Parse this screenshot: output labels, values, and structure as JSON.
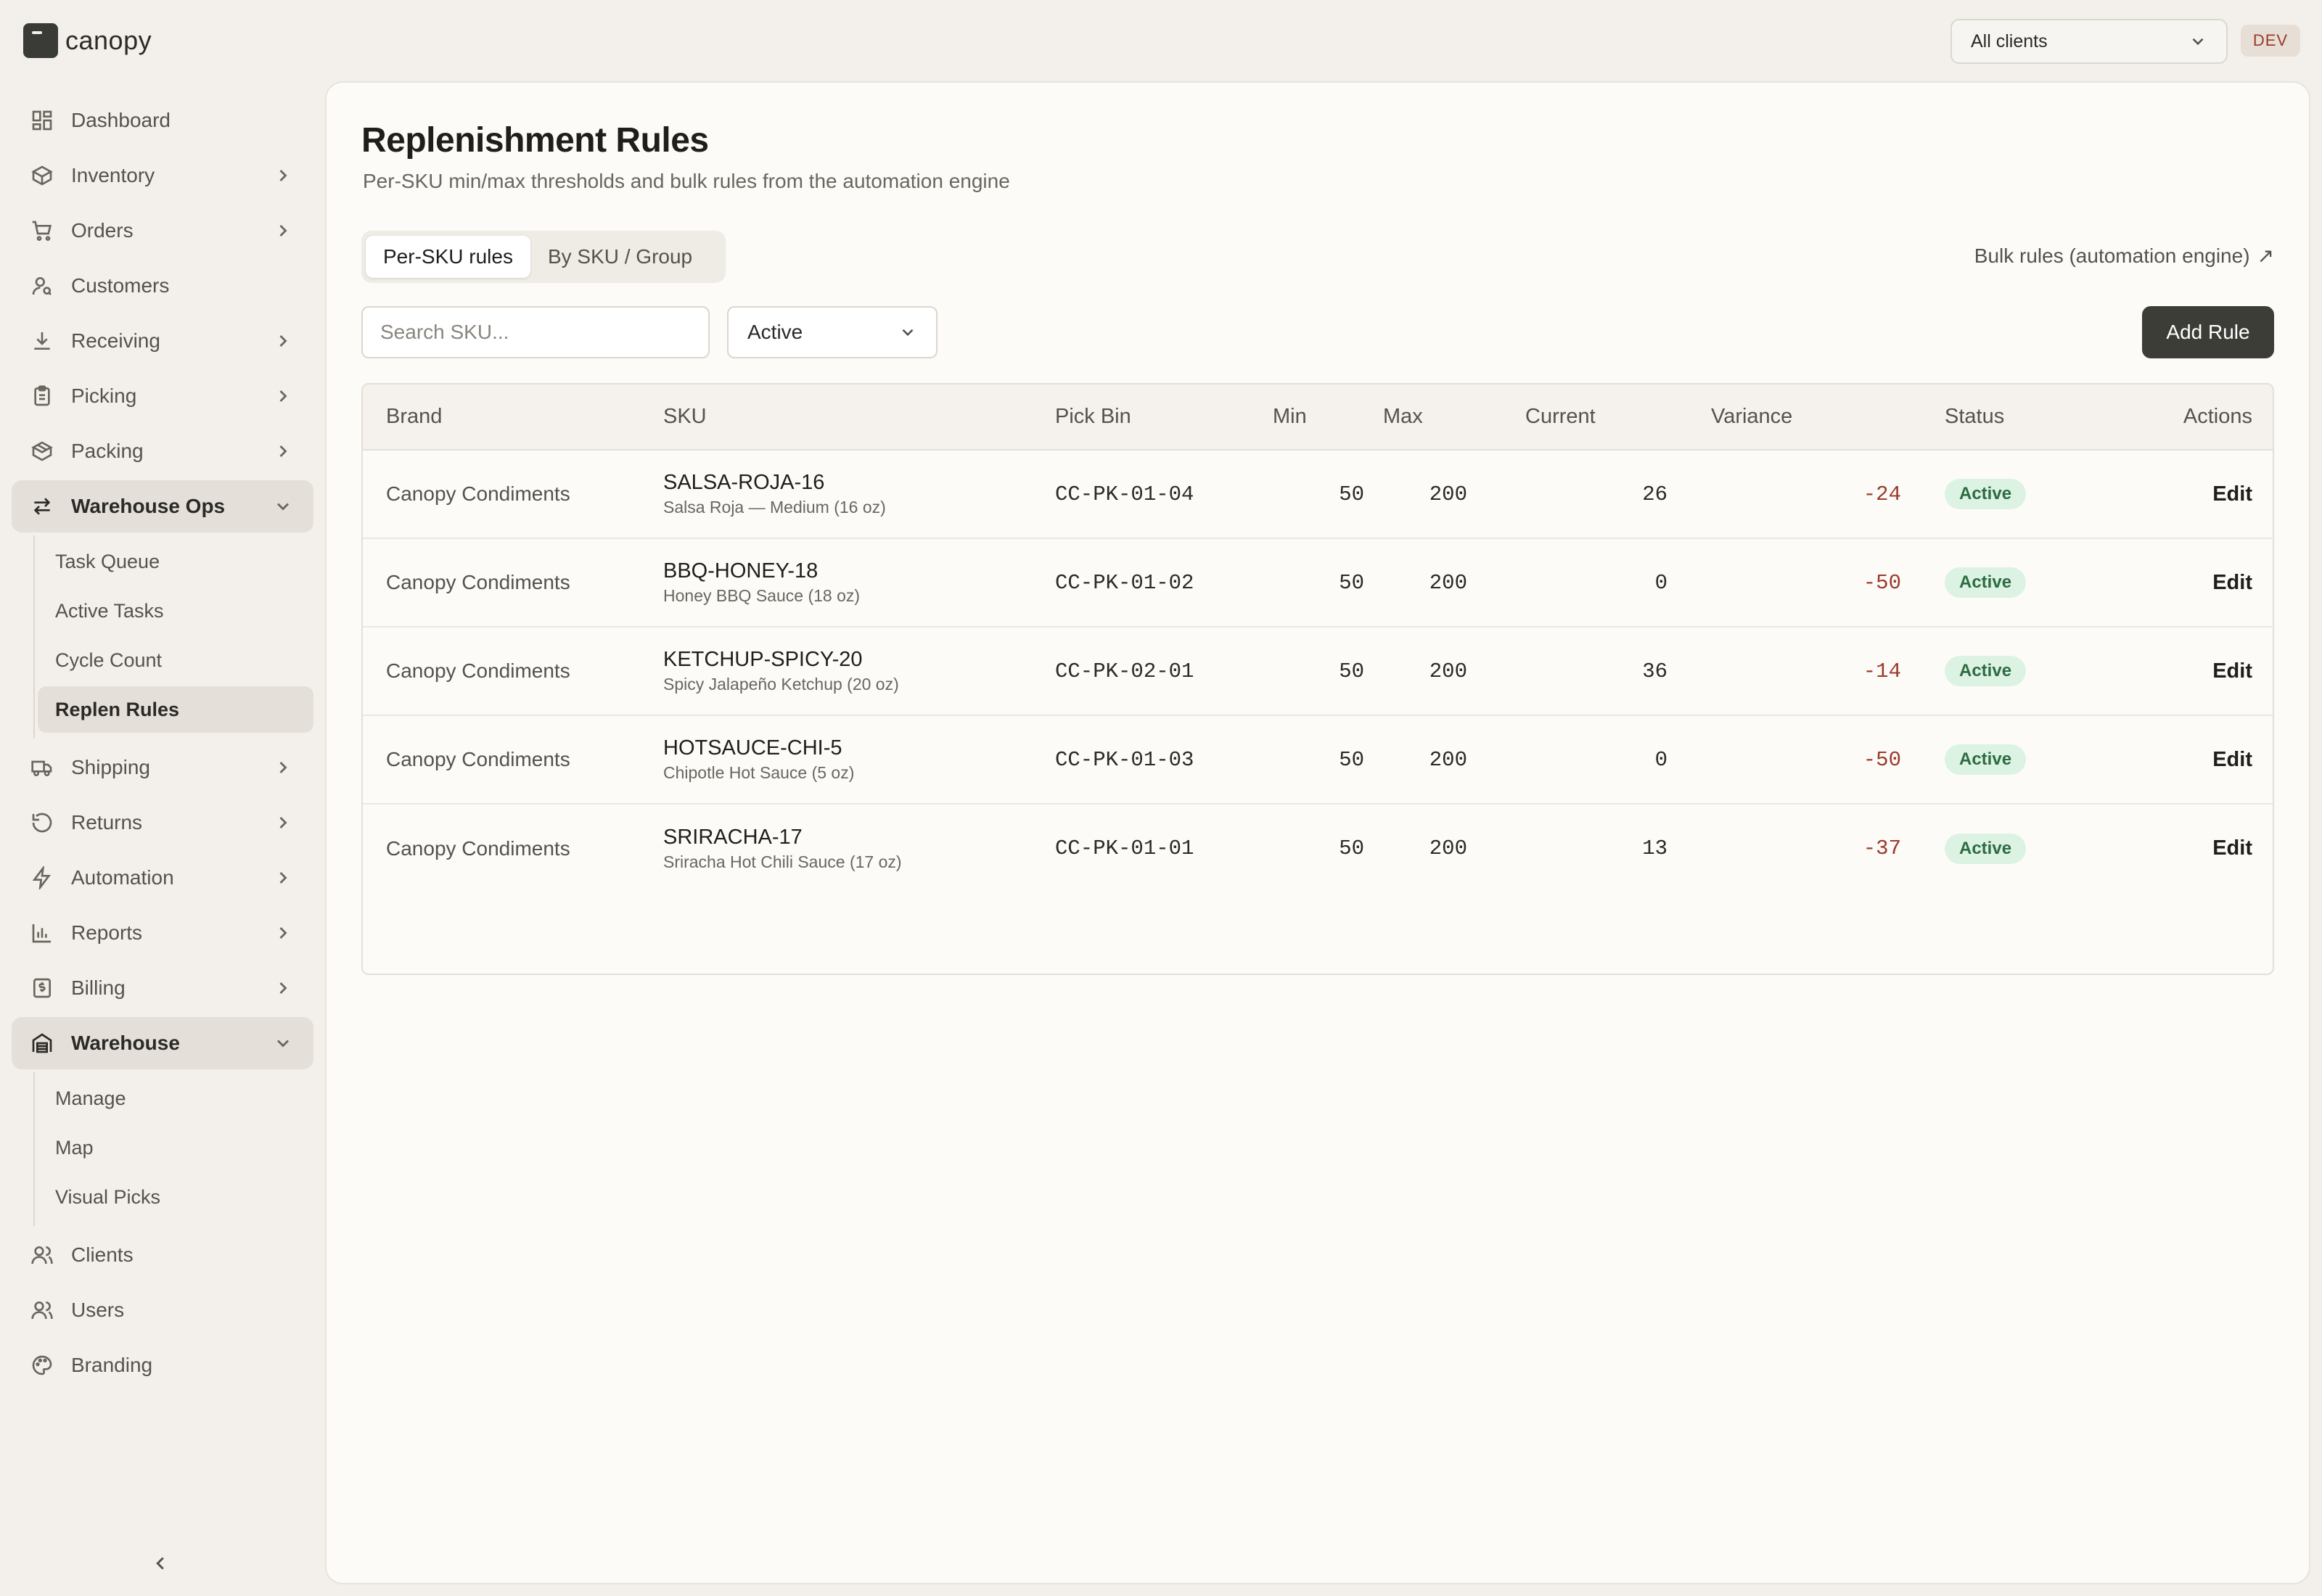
{
  "app": {
    "logo_text": "canopy",
    "client_select": "All clients",
    "env_badge": "DEV"
  },
  "sidebar": {
    "items": [
      {
        "label": "Dashboard",
        "icon": "dashboard-icon",
        "chevron": false
      },
      {
        "label": "Inventory",
        "icon": "box-icon",
        "chevron": true
      },
      {
        "label": "Orders",
        "icon": "cart-icon",
        "chevron": true
      },
      {
        "label": "Customers",
        "icon": "user-search-icon",
        "chevron": false
      },
      {
        "label": "Receiving",
        "icon": "download-icon",
        "chevron": true
      },
      {
        "label": "Picking",
        "icon": "clipboard-icon",
        "chevron": true
      },
      {
        "label": "Packing",
        "icon": "package-icon",
        "chevron": true
      },
      {
        "label": "Warehouse Ops",
        "icon": "arrows-exchange-icon",
        "expanded": true,
        "children": [
          "Task Queue",
          "Active Tasks",
          "Cycle Count",
          "Replen Rules"
        ],
        "active_child": "Replen Rules"
      },
      {
        "label": "Shipping",
        "icon": "truck-icon",
        "chevron": true
      },
      {
        "label": "Returns",
        "icon": "rotate-ccw-icon",
        "chevron": true
      },
      {
        "label": "Automation",
        "icon": "bolt-icon",
        "chevron": true
      },
      {
        "label": "Reports",
        "icon": "bar-chart-icon",
        "chevron": true
      },
      {
        "label": "Billing",
        "icon": "dollar-receipt-icon",
        "chevron": true
      },
      {
        "label": "Warehouse",
        "icon": "warehouse-icon",
        "expanded": true,
        "children": [
          "Manage",
          "Map",
          "Visual Picks"
        ]
      },
      {
        "label": "Clients",
        "icon": "users-icon",
        "chevron": false
      },
      {
        "label": "Users",
        "icon": "users-icon",
        "chevron": false
      },
      {
        "label": "Branding",
        "icon": "palette-icon",
        "chevron": false
      }
    ]
  },
  "page": {
    "title": "Replenishment Rules",
    "subtitle": "Per-SKU min/max thresholds and bulk rules from the automation engine",
    "tabs": [
      "Per-SKU rules",
      "By SKU / Group"
    ],
    "active_tab": "Per-SKU rules",
    "bulk_link": "Bulk rules (automation engine)",
    "bulk_link_icon": "arrow-up-right-icon",
    "search_placeholder": "Search SKU...",
    "status_filter": "Active",
    "add_button": "Add Rule"
  },
  "table": {
    "columns": [
      "Brand",
      "SKU",
      "Pick Bin",
      "Min",
      "Max",
      "Current",
      "Variance",
      "Status",
      "Actions"
    ],
    "rows": [
      {
        "brand": "Canopy Condiments",
        "sku": "SALSA-ROJA-16",
        "name": "Salsa Roja — Medium (16 oz)",
        "bin": "CC-PK-01-04",
        "min": "50",
        "max": "200",
        "current": "26",
        "variance": "-24",
        "status": "Active",
        "action": "Edit"
      },
      {
        "brand": "Canopy Condiments",
        "sku": "BBQ-HONEY-18",
        "name": "Honey BBQ Sauce (18 oz)",
        "bin": "CC-PK-01-02",
        "min": "50",
        "max": "200",
        "current": "0",
        "variance": "-50",
        "status": "Active",
        "action": "Edit"
      },
      {
        "brand": "Canopy Condiments",
        "sku": "KETCHUP-SPICY-20",
        "name": "Spicy Jalapeño Ketchup (20 oz)",
        "bin": "CC-PK-02-01",
        "min": "50",
        "max": "200",
        "current": "36",
        "variance": "-14",
        "status": "Active",
        "action": "Edit"
      },
      {
        "brand": "Canopy Condiments",
        "sku": "HOTSAUCE-CHI-5",
        "name": "Chipotle Hot Sauce (5 oz)",
        "bin": "CC-PK-01-03",
        "min": "50",
        "max": "200",
        "current": "0",
        "variance": "-50",
        "status": "Active",
        "action": "Edit"
      },
      {
        "brand": "Canopy Condiments",
        "sku": "SRIRACHA-17",
        "name": "Sriracha Hot Chili Sauce (17 oz)",
        "bin": "CC-PK-01-01",
        "min": "50",
        "max": "200",
        "current": "13",
        "variance": "-37",
        "status": "Active",
        "action": "Edit"
      }
    ]
  },
  "colors": {
    "accent_dark": "#3d3d38",
    "variance_negative": "#9b3a2a",
    "status_active_bg": "#dcf3e3",
    "status_active_text": "#2e6b43"
  }
}
